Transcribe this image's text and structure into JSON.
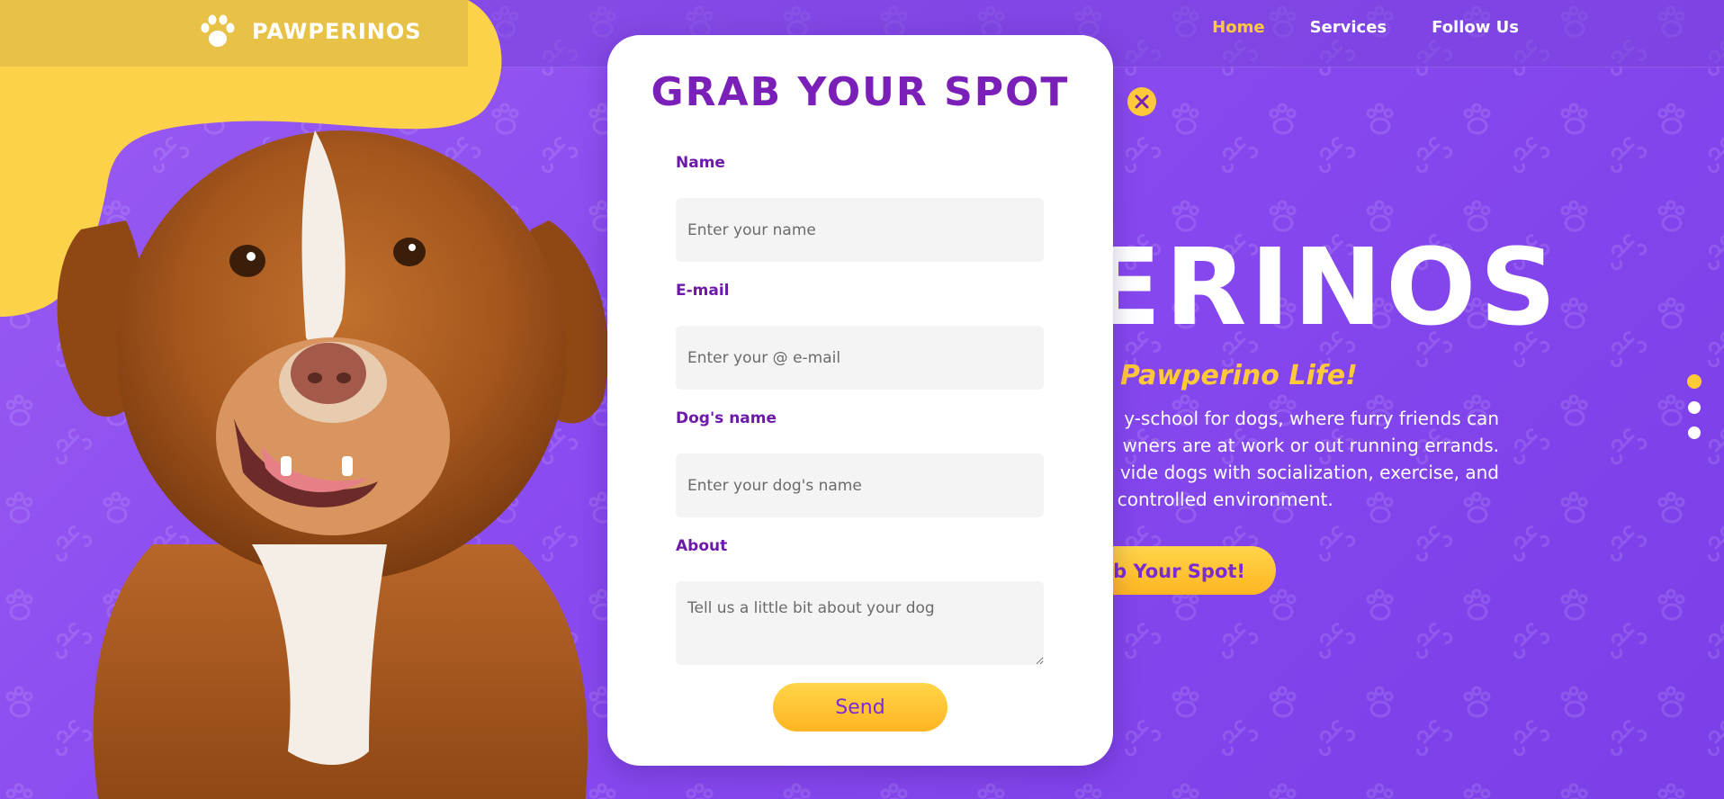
{
  "brand": {
    "name": "PAWPERINOS",
    "icon": "paw-icon"
  },
  "nav": {
    "items": [
      {
        "label": "Home",
        "active": true
      },
      {
        "label": "Services",
        "active": false
      },
      {
        "label": "Follow Us",
        "active": false
      }
    ]
  },
  "hero": {
    "title": "ERINOS",
    "subtitle": "Pawperino Life!",
    "description_lines": [
      "y-school for dogs, where furry friends can",
      "wners are at work or out running errands.",
      "vide dogs with socialization, exercise, and",
      "nd controlled environment."
    ],
    "cta_label": "rab Your Spot!"
  },
  "carousel": {
    "slides": 3,
    "active_index": 0
  },
  "modal": {
    "title": "GRAB YOUR SPOT",
    "close_icon": "close-icon",
    "fields": {
      "name": {
        "label": "Name",
        "placeholder": "Enter your name",
        "value": ""
      },
      "email": {
        "label": "E-mail",
        "placeholder": "Enter your @ e-mail",
        "value": ""
      },
      "dog_name": {
        "label": "Dog's name",
        "placeholder": "Enter your dog's name",
        "value": ""
      },
      "about": {
        "label": "About",
        "placeholder": "Tell us a little bit about your dog",
        "value": ""
      }
    },
    "send_label": "Send"
  },
  "colors": {
    "background_purple": "#8a4bf0",
    "brand_yellow": "#ffc93a",
    "modal_title_purple": "#7a1fb8",
    "label_purple": "#6e1aa8",
    "input_bg": "#f4f4f4",
    "white": "#ffffff"
  }
}
